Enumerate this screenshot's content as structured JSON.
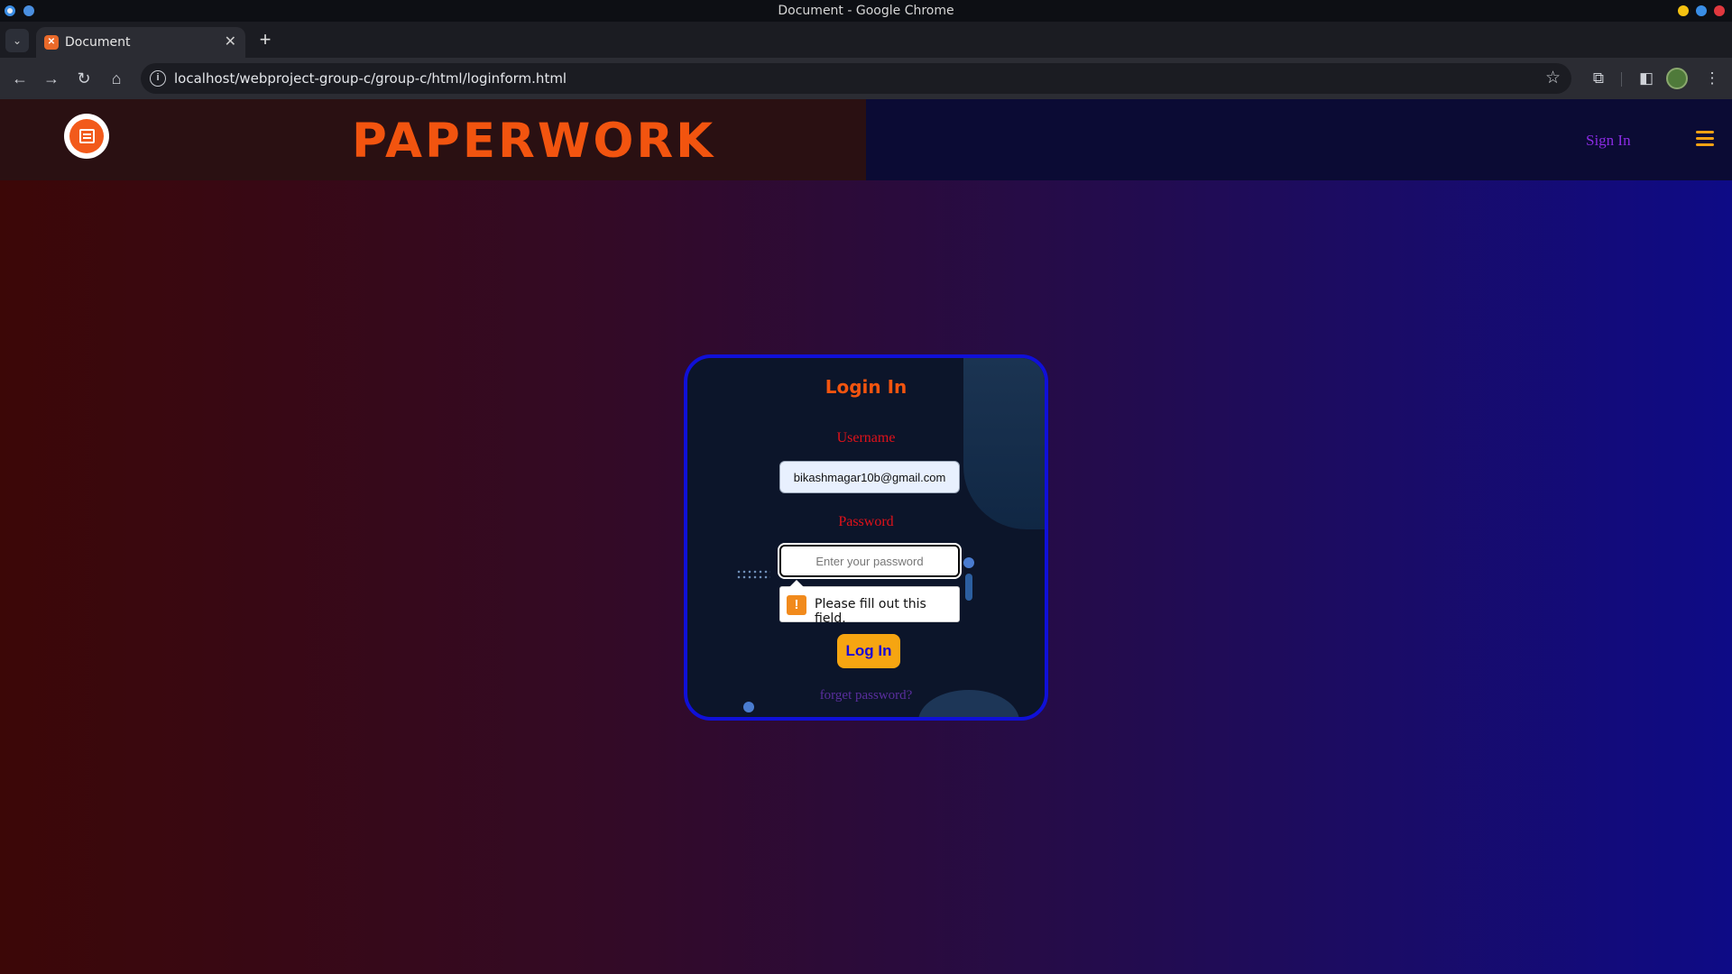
{
  "window": {
    "title": "Document - Google Chrome",
    "colors": {
      "dot_yellow": "#f5c211",
      "dot_blue": "#3a8ee6",
      "dot_red": "#e0383e"
    }
  },
  "browser": {
    "tab_title": "Document",
    "url": "localhost/webproject-group-c/group-c/html/loginform.html",
    "icons": [
      "tab-list-icon",
      "close-icon",
      "plus-icon",
      "back-icon",
      "forward-icon",
      "reload-icon",
      "home-icon",
      "info-icon",
      "star-icon",
      "extensions-icon",
      "side-panel-icon",
      "profile-avatar",
      "kebab-menu-icon"
    ]
  },
  "site": {
    "brand": "PAPERWORK",
    "nav_signin": "Sign In",
    "colors": {
      "brand": "#f2540f",
      "accent": "#f5a214",
      "link": "#8a2be2"
    }
  },
  "login_card": {
    "title": "Login In",
    "username_label": "Username",
    "username_value": "bikashmagar10b@gmail.com",
    "password_label": "Password",
    "password_placeholder": "Enter your password",
    "validation_message": "Please fill out this field.",
    "submit_label": "Log In",
    "forget_link": "forget password?"
  }
}
